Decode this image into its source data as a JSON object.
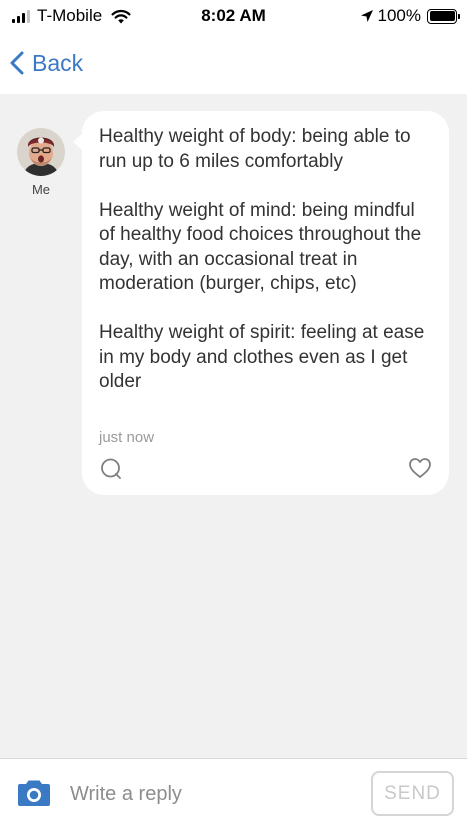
{
  "status_bar": {
    "carrier": "T-Mobile",
    "time": "8:02 AM",
    "battery": "100%",
    "battery_level": 1.0,
    "signal_bars_filled": 3,
    "signal_bars_total": 4
  },
  "nav": {
    "back_label": "Back"
  },
  "message": {
    "author": "Me",
    "paragraphs": [
      "Healthy weight of body: being able to run up to 6 miles comfortably",
      "Healthy weight of mind: being mindful of healthy food choices throughout the day, with an occasional treat in moderation (burger, chips, etc)",
      "Healthy weight of spirit: feeling at ease in my body and clothes even as I get older"
    ],
    "timestamp": "just now"
  },
  "reply": {
    "placeholder": "Write a reply",
    "send_label": "SEND"
  },
  "colors": {
    "accent": "#3a79c4",
    "background": "#f1f1f1",
    "bubble": "#ffffff",
    "muted_text": "#9a9a9a"
  },
  "icons": {
    "back": "chevron-left-icon",
    "comment": "comment-icon",
    "like": "heart-icon",
    "camera": "camera-icon",
    "location": "location-arrow-icon",
    "wifi": "wifi-icon",
    "battery": "battery-icon",
    "signal": "signal-icon"
  }
}
